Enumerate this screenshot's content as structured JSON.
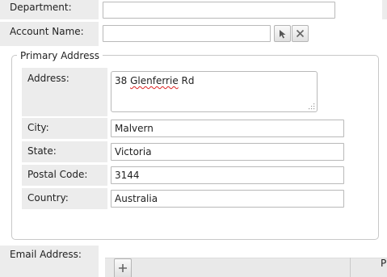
{
  "fields": {
    "department": {
      "label": "Department:",
      "value": ""
    },
    "account_name": {
      "label": "Account Name:",
      "value": ""
    }
  },
  "primary_address": {
    "legend": "Primary Address",
    "address": {
      "label": "Address:",
      "value_prefix": "38 ",
      "value_misspelled": "Glenferrie",
      "value_suffix": " Rd"
    },
    "city": {
      "label": "City:",
      "value": "Malvern"
    },
    "state": {
      "label": "State:",
      "value": "Victoria"
    },
    "postal_code": {
      "label": "Postal Code:",
      "value": "3144"
    },
    "country": {
      "label": "Country:",
      "value": "Australia"
    }
  },
  "email": {
    "label": "Email Address:",
    "partial_header": "P"
  },
  "icons": {
    "select": "cursor-arrow-icon",
    "clear": "x-icon",
    "add": "plus-icon",
    "resize": "resize-grip-icon"
  }
}
